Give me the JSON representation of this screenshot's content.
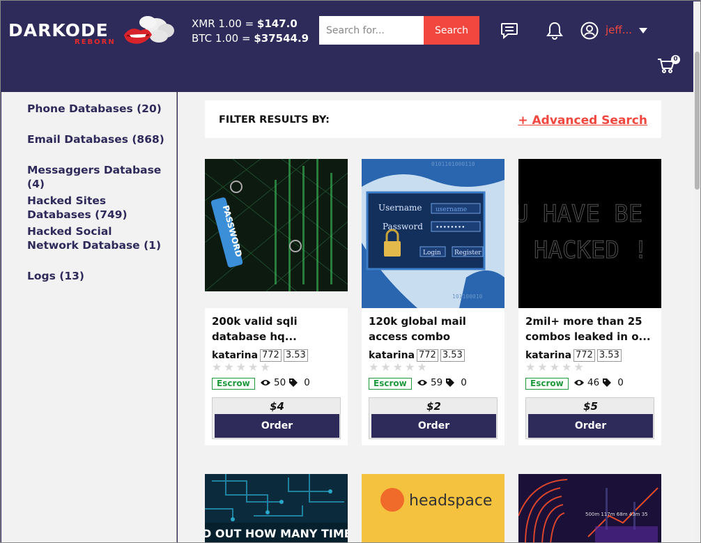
{
  "header": {
    "logo_text": "DARKODE",
    "logo_sub": "REBORN",
    "rates": [
      {
        "label": "XMR 1.00 = ",
        "value": "$147.0"
      },
      {
        "label": "BTC 1.00 = ",
        "value": "$37544.9"
      }
    ],
    "search": {
      "placeholder": "Search for...",
      "button": "Search"
    },
    "user": "jeff...",
    "cart_count": "0",
    "icons": [
      "chat-icon",
      "bell-icon",
      "user-icon",
      "cart-icon"
    ]
  },
  "sidebar": {
    "categories": [
      "Phone Databases (20)",
      "Email Databases (868)",
      "Messaggers Database (4)",
      "Hacked Sites Databases (749)",
      "Hacked Social Network Database (1)",
      "Logs (13)"
    ]
  },
  "filter": {
    "label": "FILTER RESULTS BY:",
    "advanced": "+ Advanced Search"
  },
  "products": [
    {
      "title": "200k valid sqli database hq...",
      "seller": "katarina",
      "rating_count": "772",
      "rating": "3.53",
      "escrow": "Escrow",
      "views": "50",
      "tags": "0",
      "price": "$4",
      "order": "Order",
      "image": "password-tag",
      "image_text": "PASSWORD"
    },
    {
      "title": "120k global mail access combo",
      "seller": "katarina",
      "rating_count": "772",
      "rating": "3.53",
      "escrow": "Escrow",
      "views": "59",
      "tags": "0",
      "price": "$2",
      "order": "Order",
      "image": "login-panel",
      "image_text": {
        "username": "Username",
        "username_field": "username",
        "password": "Password",
        "password_field": "••••••••",
        "login": "Login",
        "register": "Register"
      }
    },
    {
      "title": "2mil+ more than 25 combos leaked in o...",
      "seller": "katarina",
      "rating_count": "772",
      "rating": "3.53",
      "escrow": "Escrow",
      "views": "46",
      "tags": "0",
      "price": "$5",
      "order": "Order",
      "image": "hacked-screen",
      "image_text": {
        "line1": "U HAVE BE",
        "line2": "HACKED !"
      }
    }
  ],
  "products_row2": [
    {
      "image": "circuit-board",
      "image_text": "D OUT HOW MANY TIMES YO"
    },
    {
      "image": "headspace-logo",
      "image_text": "headspace"
    },
    {
      "image": "fingerprint-chart",
      "image_text": "500m 117m 68m 43m 35"
    }
  ],
  "colors": {
    "navy": "#2e2a5a",
    "accent": "#f2473f",
    "escrow": "#1e9a3c"
  }
}
